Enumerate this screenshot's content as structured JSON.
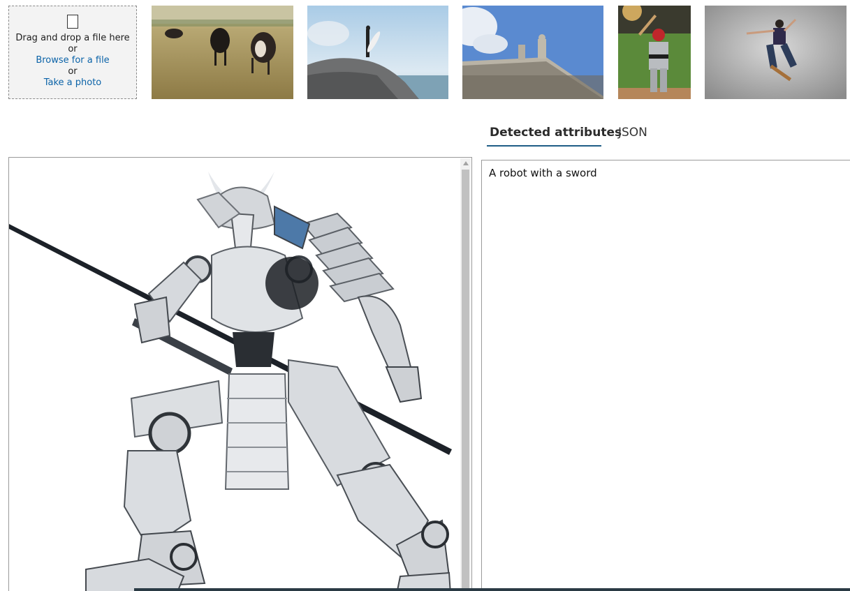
{
  "upload": {
    "drag_text": "Drag and drop a file here",
    "or_1": "or",
    "browse_link": "Browse for a file",
    "or_2": "or",
    "photo_link": "Take a photo"
  },
  "samples": [
    {
      "subject": "cows grazing"
    },
    {
      "subject": "surfer on rock"
    },
    {
      "subject": "building statues"
    },
    {
      "subject": "baseball batter"
    },
    {
      "subject": "skateboarder"
    }
  ],
  "tabs": [
    {
      "label": "Detected attributes",
      "active": true
    },
    {
      "label": "JSON",
      "active": false
    }
  ],
  "result": {
    "caption": "A robot with a sword"
  },
  "colors": {
    "link": "#0b63a8",
    "tab_underline": "#1f5d86"
  }
}
